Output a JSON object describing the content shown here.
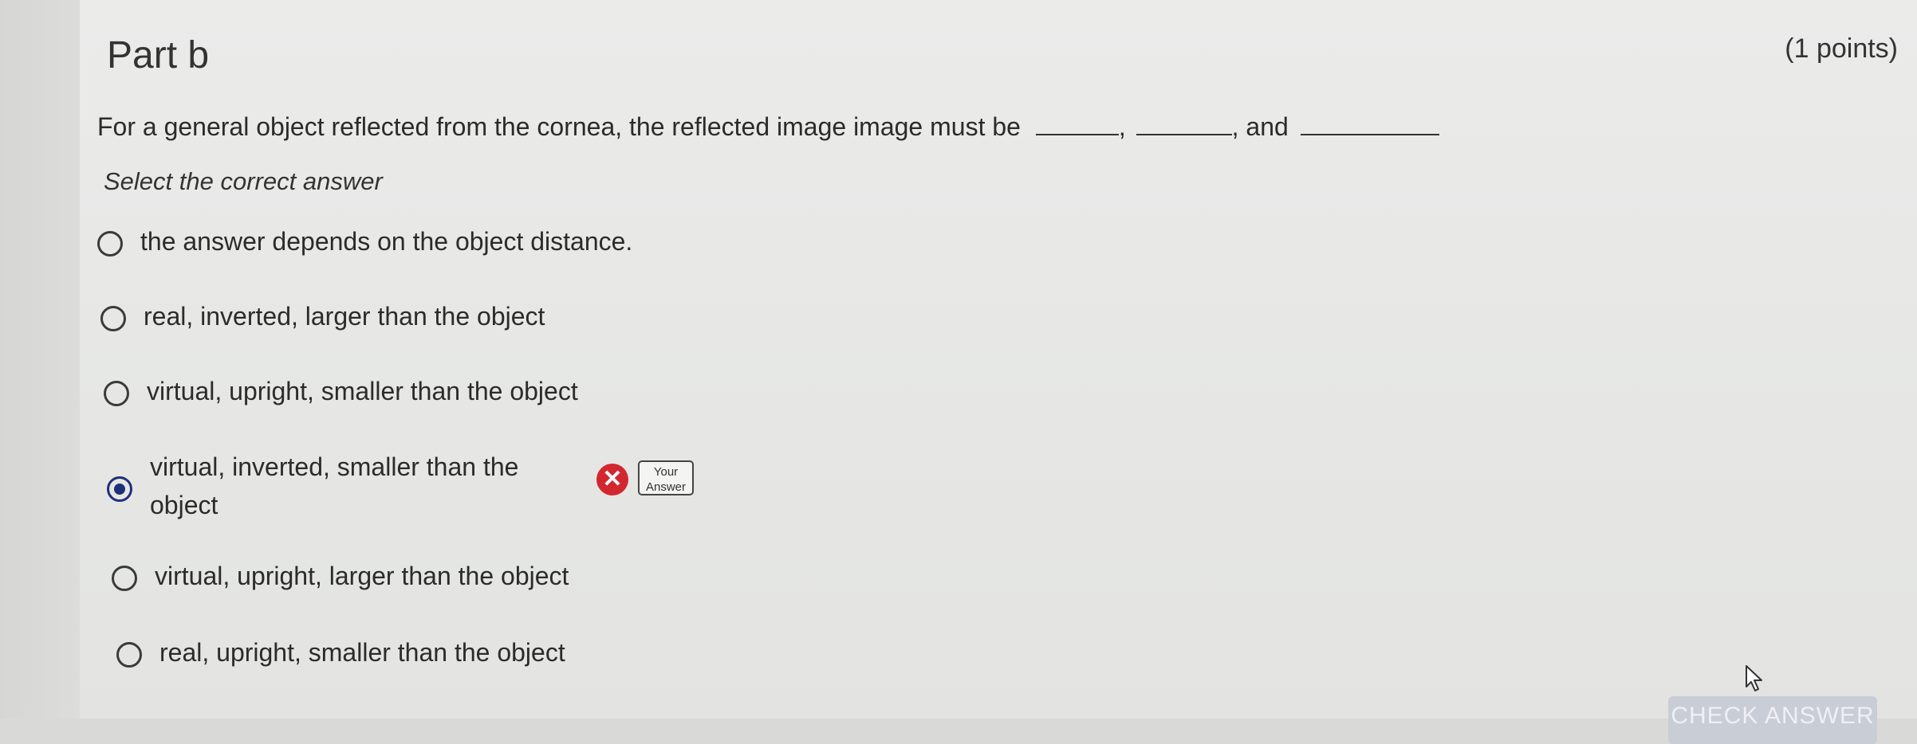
{
  "header": {
    "title": "Part b",
    "points": "(1 points)"
  },
  "question": {
    "text": "For a general object reflected from the cornea, the reflected image image must be",
    "sep1": ",",
    "sep2": ", and"
  },
  "instruction": "Select the correct answer",
  "options": [
    {
      "label": "the answer depends on the object distance.",
      "selected": false
    },
    {
      "label": "real, inverted, larger than the object",
      "selected": false
    },
    {
      "label": "virtual, upright, smaller than the object",
      "selected": false
    },
    {
      "label": "virtual, inverted, smaller than the object",
      "selected": true
    },
    {
      "label": "virtual, upright, larger than the object",
      "selected": false
    },
    {
      "label": "real, upright, smaller than the object",
      "selected": false
    }
  ],
  "feedback": {
    "wrong_icon": "x-circle-icon",
    "your_answer_line1": "Your",
    "your_answer_line2": "Answer",
    "wrong_color": "#d3272f"
  },
  "actions": {
    "check_answer_label": "CHECK ANSWER"
  },
  "colors": {
    "selected_radio": "#1f2f7a",
    "button_bg": "#c9cdd6"
  }
}
